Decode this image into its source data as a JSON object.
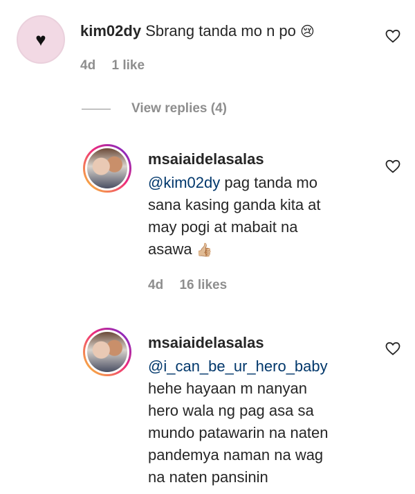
{
  "comments": [
    {
      "username": "kim02dy",
      "text": "Sbrang tanda mo n po",
      "emoji": "😢",
      "age": "4d",
      "likes": "1 like",
      "avatar_icon": "heart-icon"
    },
    {
      "username": "msaiaidelasalas",
      "mention": "@kim02dy",
      "text_lines": [
        "pag tanda mo",
        "sana kasing ganda kita at",
        "may pogi at mabait na",
        "asawa"
      ],
      "emoji": "👍🏼",
      "age": "4d",
      "likes": "16 likes"
    },
    {
      "username": "msaiaidelasalas",
      "mention": "@i_can_be_ur_hero_baby",
      "text_lines": [
        "hehe hayaan m nanyan",
        "hero wala ng pag asa sa",
        "mundo patawarin na naten",
        "pandemya naman na wag",
        "na naten pansinin"
      ]
    }
  ],
  "view_replies": "View replies (4)",
  "colors": {
    "mention": "#00376b",
    "meta": "#8e8e8e",
    "avatar_bg": "#f2d9e4"
  }
}
